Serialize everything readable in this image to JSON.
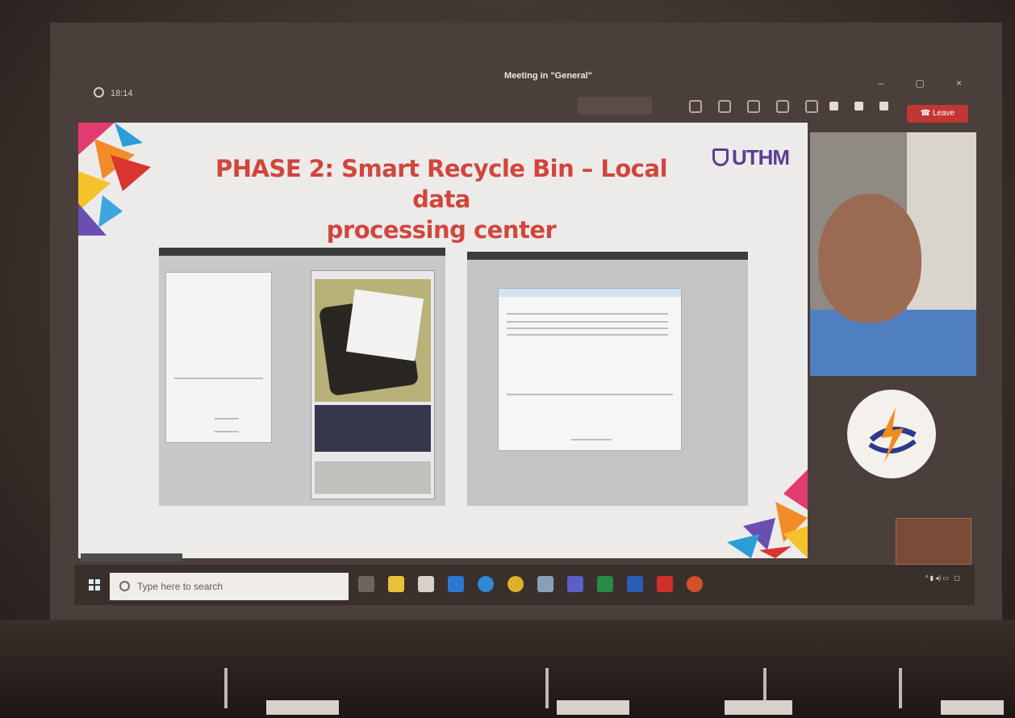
{
  "teams": {
    "timer": "18:14",
    "meeting_title": "Meeting in \"General\"",
    "leave_label": "Leave"
  },
  "slide": {
    "title_line1": "PHASE 2: Smart Recycle Bin – Local data",
    "title_line2": "processing center",
    "logo_text": "UTHM"
  },
  "taskbar": {
    "search_placeholder": "Type here to search"
  },
  "colors": {
    "slide_title": "#d0463e",
    "logo": "#5b3f8f",
    "leave_button": "#c23634"
  },
  "icons": [
    "windows-start-icon",
    "search-icon",
    "task-view-icon",
    "file-explorer-icon",
    "store-icon",
    "mail-icon",
    "edge-icon",
    "chrome-icon",
    "teams-icon",
    "excel-icon",
    "word-icon",
    "acrobat-icon",
    "powerpoint-icon"
  ]
}
